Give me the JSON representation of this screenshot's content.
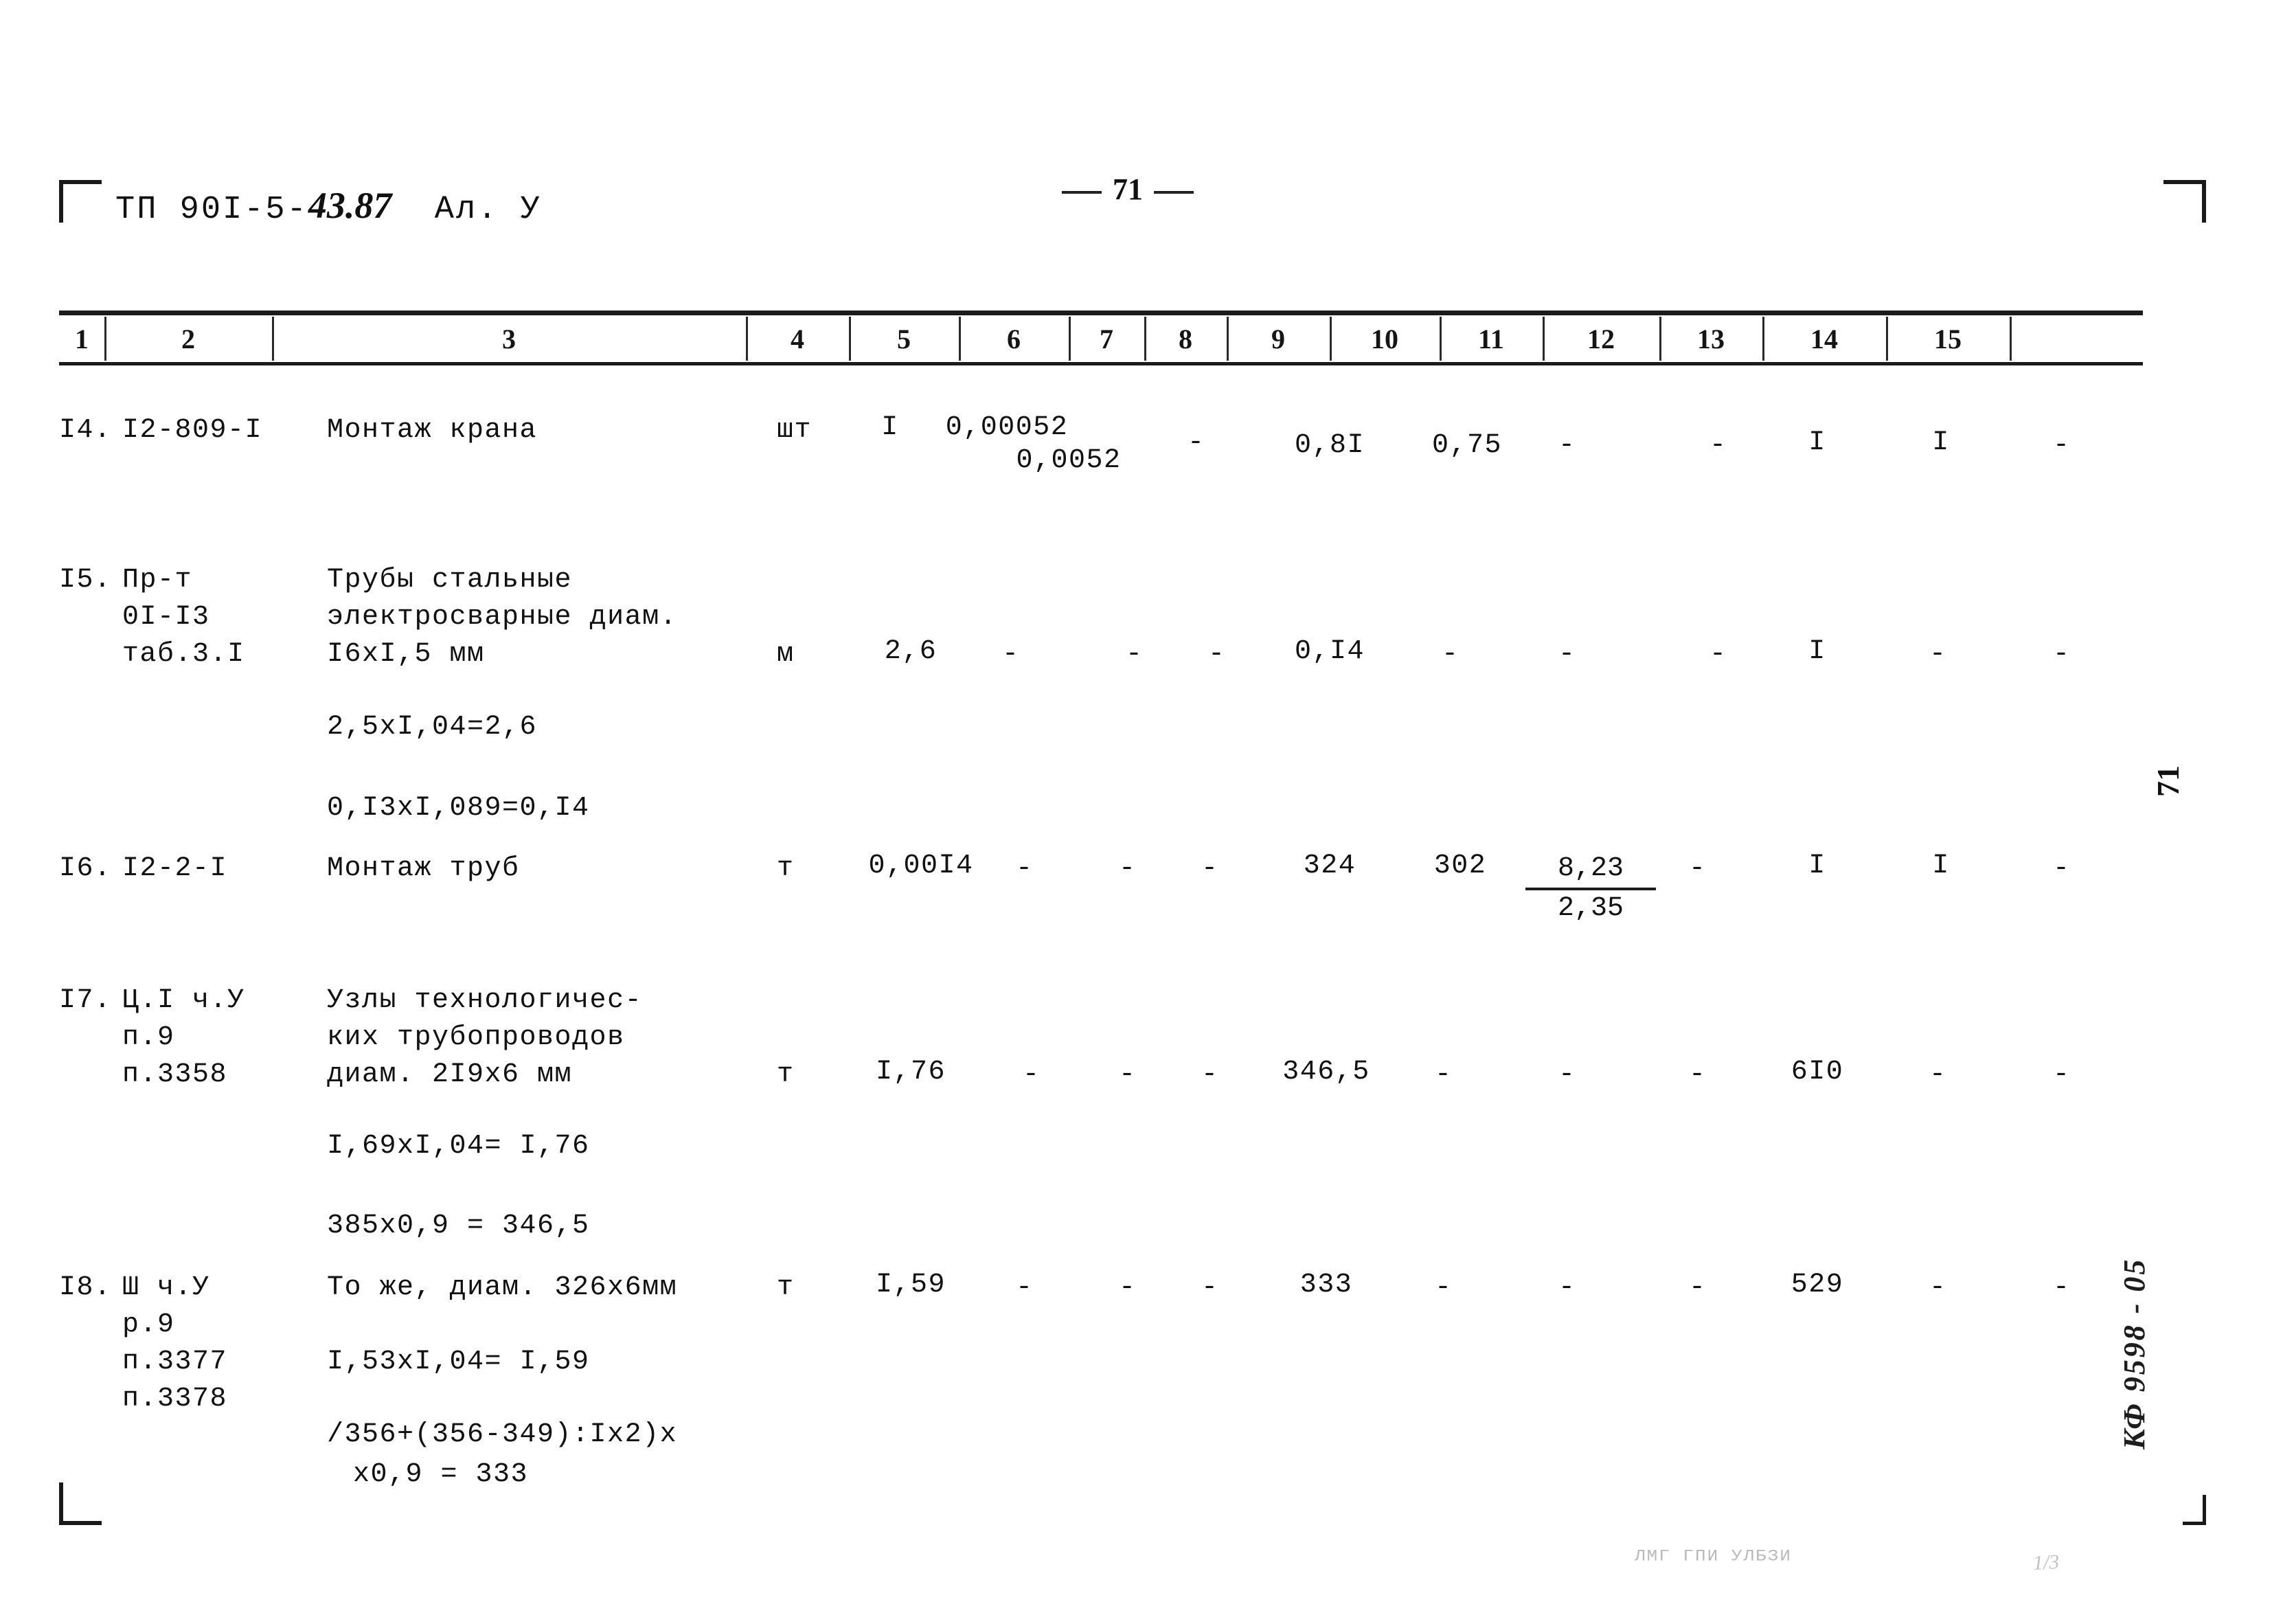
{
  "header": {
    "doc_code_prefix": "ТП 90I-5-",
    "doc_code_hand": "43.87",
    "album": "Ал. У",
    "folio": "71"
  },
  "table": {
    "column_numbers": [
      "1",
      "2",
      "3",
      "4",
      "5",
      "6",
      "7",
      "8",
      "9",
      "10",
      "11",
      "12",
      "13",
      "14",
      "15"
    ]
  },
  "rows": [
    {
      "no": "I4.",
      "code": "I2-809-I",
      "description": "Монтаж крана",
      "unit": "шт",
      "c5": "I",
      "c6": "0,00052",
      "c6b": "0,0052",
      "c7": "-",
      "c9": "0,8I",
      "c10": "0,75",
      "c11": "-",
      "c12": "-",
      "c13": "I",
      "c14": "I",
      "c15": "-"
    },
    {
      "no": "I5.",
      "code_l1": "Пр-т",
      "code_l2": "0I-I3",
      "code_l3": "таб.3.I",
      "desc_l1": "Трубы стальные",
      "desc_l2": "электросварные диам.",
      "desc_l3": "I6xI,5 мм",
      "unit": "м",
      "c5": "2,6",
      "c6": "-",
      "c7": "-",
      "c8": "-",
      "c9": "0,I4",
      "c10": "-",
      "c11": "-",
      "c12": "-",
      "c13": "I",
      "c14": "-",
      "c15": "-",
      "calc1": "2,5xI,04=2,6",
      "calc2": "0,I3xI,089=0,I4"
    },
    {
      "no": "I6.",
      "code": "I2-2-I",
      "description": "Монтаж труб",
      "unit": "т",
      "c5": "0,00I4",
      "c6": "-",
      "c7": "-",
      "c8": "-",
      "c9": "324",
      "c10": "302",
      "c11_top": "8,23",
      "c11_bot": "2,35",
      "c12": "-",
      "c13": "I",
      "c14": "I",
      "c15": "-"
    },
    {
      "no": "I7.",
      "code_l1": "Ц.I ч.У",
      "code_l2": "п.9",
      "code_l3": "п.3358",
      "desc_l1": "Узлы технологичес-",
      "desc_l2": "ких трубопроводов",
      "desc_l3": "диам. 2I9x6 мм",
      "unit": "т",
      "c5": "I,76",
      "c6": "-",
      "c7": "-",
      "c8": "-",
      "c9": "346,5",
      "c10": "-",
      "c11": "-",
      "c12": "-",
      "c13": "6I0",
      "c14": "-",
      "c15": "-",
      "calc1": "I,69xI,04= I,76",
      "calc2": "385x0,9 = 346,5"
    },
    {
      "no": "I8.",
      "code_l1": "Ш ч.У",
      "code_l2": "р.9",
      "code_l3": "п.3377",
      "code_l4": "п.3378",
      "desc_l1": "То же, диам. 326x6мм",
      "unit": "т",
      "c5": "I,59",
      "c6": "-",
      "c7": "-",
      "c8": "-",
      "c9": "333",
      "c10": "-",
      "c11": "-",
      "c12": "-",
      "c13": "529",
      "c14": "-",
      "c15": "-",
      "calc1": "I,53xI,04= I,59",
      "calc2": "/356+(356-349):Ix2)x",
      "calc3": "x0,9 = 333"
    }
  ],
  "margin": {
    "page_rotated": "71",
    "archive_mark": "КФ 9598 - 05"
  },
  "footer": {
    "stamp_faint": "ЛМГ ГПИ УЛБЗИ",
    "stamp_hand": "1/3"
  }
}
